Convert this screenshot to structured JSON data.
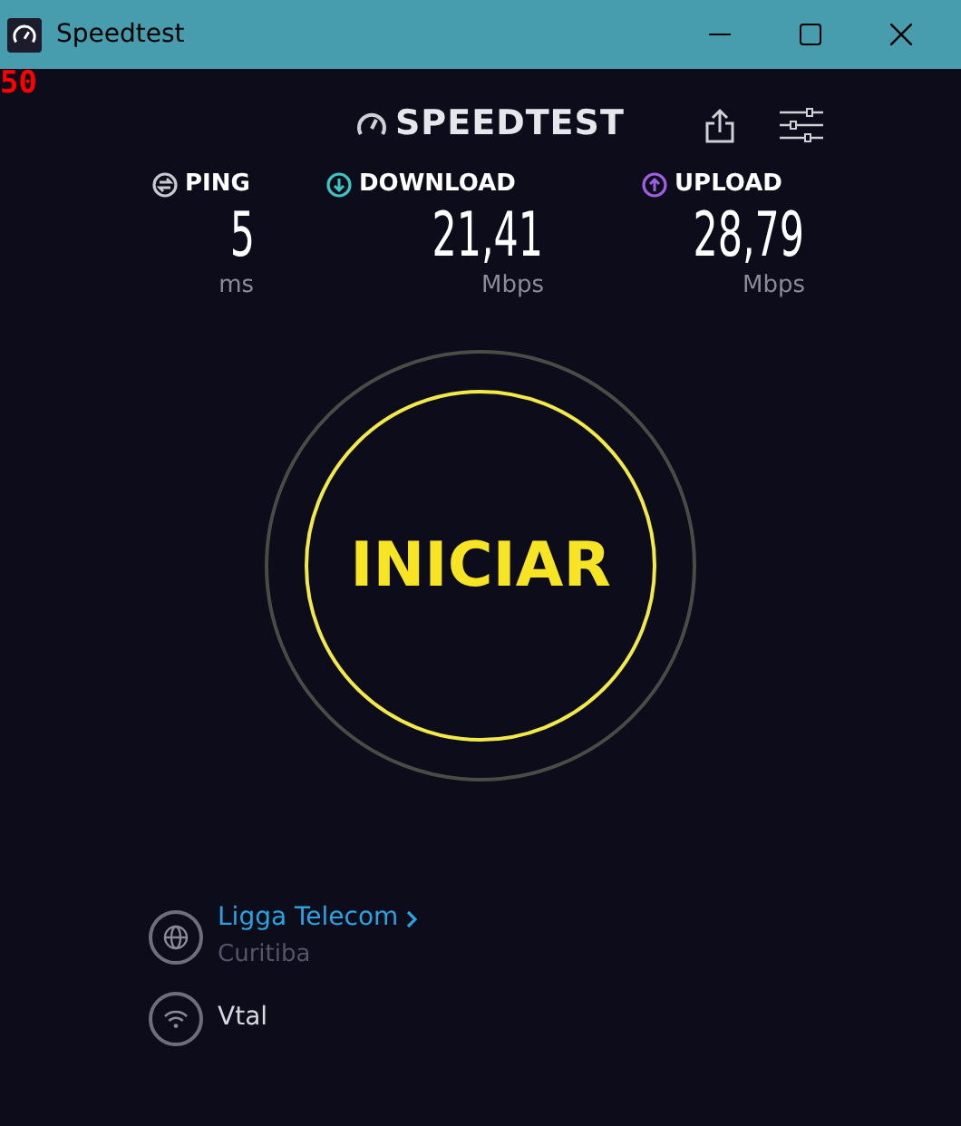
{
  "window": {
    "title": "Speedtest"
  },
  "overlay_counter": "50",
  "logo": "SPEEDTEST",
  "metrics": [
    {
      "kind": "ping",
      "label": "PING",
      "value": "5",
      "unit": "ms",
      "color": "#c8c8d0"
    },
    {
      "kind": "download",
      "label": "DOWNLOAD",
      "value": "21,41",
      "unit": "Mbps",
      "color": "#3dc6c1"
    },
    {
      "kind": "upload",
      "label": "UPLOAD",
      "value": "28,79",
      "unit": "Mbps",
      "color": "#a05ee0"
    }
  ],
  "start_button": {
    "label": "INICIAR"
  },
  "server": {
    "name": "Ligga Telecom",
    "location": "Curitiba"
  },
  "provider": {
    "name": "Vtal"
  }
}
